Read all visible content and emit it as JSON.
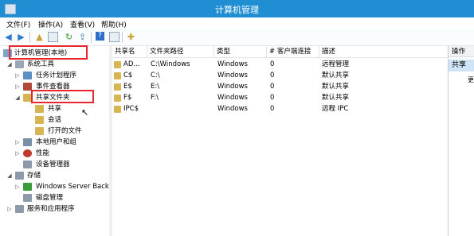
{
  "window": {
    "title": "计算机管理"
  },
  "menu": [
    "文件(F)",
    "操作(A)",
    "查看(V)",
    "帮助(H)"
  ],
  "tree": {
    "root": "计算机管理(本地)",
    "system_tools": "系统工具",
    "task_scheduler": "任务计划程序",
    "event_viewer": "事件查看器",
    "shared_folders": "共享文件夹",
    "shares": "共享",
    "sessions": "会话",
    "open_files": "打开的文件",
    "local_users": "本地用户和组",
    "performance": "性能",
    "device_manager": "设备管理器",
    "storage": "存储",
    "windows_server_backup": "Windows Server Back",
    "disk_management": "磁盘管理",
    "services_apps": "服务和应用程序"
  },
  "list": {
    "columns": [
      "共享名",
      "文件夹路径",
      "类型",
      "# 客户端连接",
      "描述"
    ],
    "rows": [
      {
        "name": "AD...",
        "path": "C:\\Windows",
        "type": "Windows",
        "clients": "0",
        "desc": "远程管理"
      },
      {
        "name": "C$",
        "path": "C:\\",
        "type": "Windows",
        "clients": "0",
        "desc": "默认共享"
      },
      {
        "name": "E$",
        "path": "E:\\",
        "type": "Windows",
        "clients": "0",
        "desc": "默认共享"
      },
      {
        "name": "F$",
        "path": "F:\\",
        "type": "Windows",
        "clients": "0",
        "desc": "默认共享"
      },
      {
        "name": "IPC$",
        "path": "",
        "type": "Windows",
        "clients": "0",
        "desc": "远程 IPC"
      }
    ]
  },
  "actions": {
    "header": "操作",
    "selected": "共享",
    "more": "更"
  }
}
